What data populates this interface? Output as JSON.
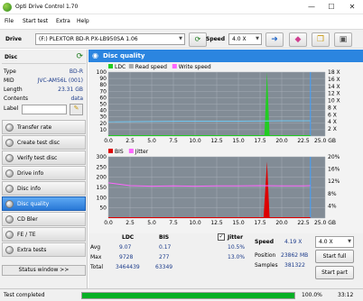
{
  "window": {
    "title": "Opti Drive Control 1.70",
    "minimize": "—",
    "maximize": "☐",
    "close": "✕"
  },
  "menu": [
    "File",
    "Start test",
    "Extra",
    "Help"
  ],
  "drivebar": {
    "drive_label": "Drive",
    "drive_value": "(F:)  PLEXTOR BD-R  PX-LB950SA 1.06",
    "speed_label": "Speed",
    "speed_value": "4.0 X"
  },
  "disc": {
    "header": "Disc",
    "rows": [
      {
        "k": "Type",
        "v": "BD-R"
      },
      {
        "k": "MID",
        "v": "JVC-AM56L (001)"
      },
      {
        "k": "Length",
        "v": "23.31 GB"
      },
      {
        "k": "Contents",
        "v": "data"
      }
    ],
    "label_key": "Label"
  },
  "nav": [
    {
      "label": "Transfer rate",
      "active": false
    },
    {
      "label": "Create test disc",
      "active": false
    },
    {
      "label": "Verify test disc",
      "active": false
    },
    {
      "label": "Drive info",
      "active": false
    },
    {
      "label": "Disc info",
      "active": false
    },
    {
      "label": "Disc quality",
      "active": true
    },
    {
      "label": "CD Bler",
      "active": false
    },
    {
      "label": "FE / TE",
      "active": false
    },
    {
      "label": "Extra tests",
      "active": false
    }
  ],
  "status_window_btn": "Status window >>",
  "main_header": "Disc quality",
  "chart_data": [
    {
      "type": "line",
      "legend": [
        "LDC",
        "Read speed",
        "Write speed"
      ],
      "colors": {
        "LDC": "#22cc22",
        "Read speed": "#aaaaaa",
        "Write speed": "#ff66ff"
      },
      "x_ticks": [
        "0.0",
        "2.5",
        "5.0",
        "7.5",
        "10.0",
        "12.5",
        "15.0",
        "17.5",
        "20.0",
        "22.5",
        "25.0 GB"
      ],
      "xlim": [
        0,
        25
      ],
      "y_left_ticks": [
        "100",
        "90",
        "80",
        "70",
        "60",
        "50",
        "40",
        "30",
        "20",
        "10"
      ],
      "y_right_ticks": [
        "18 X",
        "16 X",
        "14 X",
        "12 X",
        "10 X",
        "8 X",
        "6 X",
        "4 X",
        "2 X"
      ],
      "ylim": [
        0,
        100
      ],
      "series": [
        {
          "name": "LDC",
          "x": [
            18.0,
            18.3,
            18.6
          ],
          "values": [
            0,
            100,
            0
          ]
        },
        {
          "name": "Read speed",
          "x": [
            0,
            5,
            10,
            15,
            20,
            23.3
          ],
          "values": [
            4.0,
            4.1,
            4.2,
            4.2,
            4.3,
            4.3
          ]
        }
      ]
    },
    {
      "type": "line",
      "legend": [
        "BIS",
        "Jitter"
      ],
      "colors": {
        "BIS": "#dd0000",
        "Jitter": "#ff66ff"
      },
      "x_ticks": [
        "0.0",
        "2.5",
        "5.0",
        "7.5",
        "10.0",
        "12.5",
        "15.0",
        "17.5",
        "20.0",
        "22.5",
        "25.0 GB"
      ],
      "xlim": [
        0,
        25
      ],
      "y_left_ticks": [
        "300",
        "250",
        "200",
        "150",
        "100",
        "50"
      ],
      "y_right_ticks": [
        "20%",
        "16%",
        "12%",
        "8%",
        "4%"
      ],
      "ylim": [
        0,
        300
      ],
      "series": [
        {
          "name": "BIS",
          "x": [
            17.9,
            18.3,
            18.6
          ],
          "values": [
            0,
            277,
            0
          ]
        },
        {
          "name": "Jitter",
          "x": [
            0,
            2.5,
            5,
            7.5,
            10,
            12.5,
            15,
            17.5,
            20,
            22.5,
            23.3
          ],
          "values": [
            11.5,
            10.6,
            10.4,
            10.5,
            10.4,
            10.5,
            10.5,
            10.6,
            10.5,
            10.5,
            10.6
          ]
        }
      ]
    }
  ],
  "stats": {
    "col_ldc": "LDC",
    "col_bis": "BIS",
    "jitter_label": "Jitter",
    "rows": [
      {
        "k": "Avg",
        "ldc": "9.07",
        "bis": "0.17",
        "jit": "10.5%"
      },
      {
        "k": "Max",
        "ldc": "9728",
        "bis": "277",
        "jit": "13.0%"
      },
      {
        "k": "Total",
        "ldc": "3464439",
        "bis": "63349",
        "jit": ""
      }
    ],
    "speed_label": "Speed",
    "speed_value": "4.19 X",
    "position_label": "Position",
    "position_value": "23862 MB",
    "samples_label": "Samples",
    "samples_value": "381322",
    "speed_select": "4.0 X",
    "start_full": "Start full",
    "start_part": "Start part"
  },
  "statusbar": {
    "text": "Test completed",
    "progress": 1.0,
    "percent": "100.0%",
    "time": "33:12"
  }
}
